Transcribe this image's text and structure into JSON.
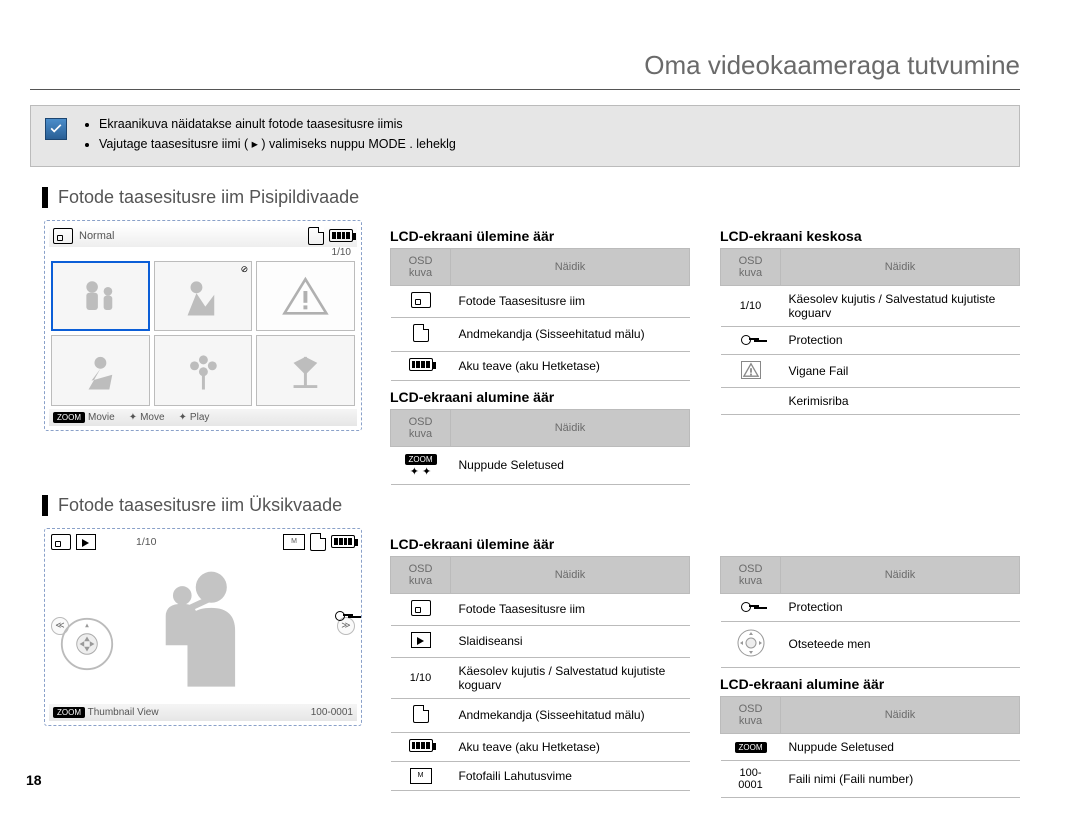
{
  "page_title": "Oma videokaameraga tutvumine",
  "page_number": "18",
  "info": {
    "bullets": [
      "Ekraanikuva näidatakse ainult fotode taasesitusre iimis",
      "Vajutage taasesitusre iimi ( ▸ ) valimiseks nuppu MODE . leheklg"
    ]
  },
  "section1": {
    "title": "Fotode taasesitusre iim  Pisipildivaade",
    "lcd": {
      "normal": "Normal",
      "count": "1/10",
      "zoom": "ZOOM",
      "movie": "Movie",
      "move": "Move",
      "play": "Play"
    },
    "top": {
      "heading": "LCD-ekraani ülemine äär",
      "col1": "OSD kuva",
      "col2": "Näidik",
      "rows": [
        {
          "icon": "photo",
          "txt": "Fotode Taasesitusre iim"
        },
        {
          "icon": "card",
          "txt": "Andmekandja (Sisseehitatud mälu)"
        },
        {
          "icon": "batt",
          "txt": "Aku teave (aku Hetketase)"
        }
      ]
    },
    "center": {
      "heading": "LCD-ekraani keskosa",
      "col1": "OSD kuva",
      "col2": "Näidik",
      "rows": [
        {
          "icon": "1/10",
          "txt": "Käesolev kujutis / Salvestatud kujutiste koguarv"
        },
        {
          "icon": "key",
          "txt": "Protection"
        },
        {
          "icon": "tri",
          "txt": "Vigane Fail"
        },
        {
          "icon": "",
          "txt": "Kerimisriba"
        }
      ]
    },
    "bottom": {
      "heading": "LCD-ekraani alumine äär",
      "col1": "OSD kuva",
      "col2": "Näidik",
      "rows": [
        {
          "icon": "zoom",
          "txt": "Nuppude Seletused"
        }
      ]
    }
  },
  "section2": {
    "title": "Fotode taasesitusre iim  Üksikvaade",
    "lcd": {
      "count": "1/10",
      "zoom": "ZOOM",
      "thumb": "Thumbnail View",
      "fileno": "100-0001"
    },
    "top": {
      "heading": "LCD-ekraani ülemine äär",
      "col1": "OSD kuva",
      "col2": "Näidik",
      "rows": [
        {
          "icon": "photo",
          "txt": "Fotode Taasesitusre iim"
        },
        {
          "icon": "slide",
          "txt": "Slaidiseansi"
        },
        {
          "icon": "1/10",
          "txt": "Käesolev kujutis / Salvestatud kujutiste koguarv"
        },
        {
          "icon": "card",
          "txt": "Andmekandja (Sisseehitatud mälu)"
        },
        {
          "icon": "batt",
          "txt": "Aku teave (aku Hetketase)"
        },
        {
          "icon": "res",
          "txt": "Fotofaili Lahutusvime"
        }
      ]
    },
    "right_top": {
      "rows": [
        {
          "icon": "key",
          "txt": "Protection"
        },
        {
          "icon": "ring",
          "txt": "Otseteede men"
        }
      ]
    },
    "bottom": {
      "heading": "LCD-ekraani alumine äär",
      "col1": "OSD kuva",
      "col2": "Näidik",
      "rows": [
        {
          "icon": "zoom",
          "txt": "Nuppude Seletused"
        },
        {
          "icon": "100-0001",
          "txt": "Faili nimi (Faili number)"
        }
      ]
    }
  }
}
